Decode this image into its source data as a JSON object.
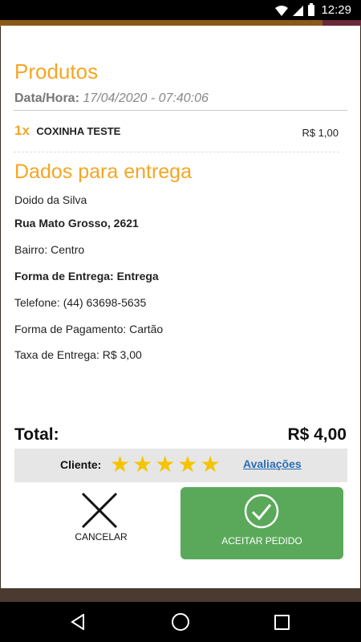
{
  "status_bar": {
    "time": "12:29"
  },
  "products": {
    "heading": "Produtos",
    "date_label": "Data/Hora:",
    "date_value": "17/04/2020 - 07:40:06",
    "items": [
      {
        "qty": "1x",
        "name": "COXINHA TESTE",
        "price": "R$ 1,00"
      }
    ]
  },
  "delivery": {
    "heading": "Dados para entrega",
    "name": "Doido da Silva",
    "address": "Rua Mato Grosso, 2621",
    "neighborhood": "Bairro: Centro",
    "delivery_method": "Forma de Entrega: Entrega",
    "phone": "Telefone: (44) 63698-5635",
    "payment": "Forma de Pagamento: Cartão",
    "fee": "Taxa de Entrega: R$ 3,00"
  },
  "total": {
    "label": "Total:",
    "value": "R$ 4,00"
  },
  "client": {
    "label": "Cliente:",
    "rating": 5,
    "rating_max": 5,
    "reviews_link": "Avaliações",
    "star_color": "#f5c400"
  },
  "actions": {
    "cancel_label": "CANCELAR",
    "accept_label": "ACEITAR PEDIDO",
    "accept_color": "#5aa95a"
  },
  "colors": {
    "accent": "#f5a623",
    "link": "#2a6db5"
  }
}
